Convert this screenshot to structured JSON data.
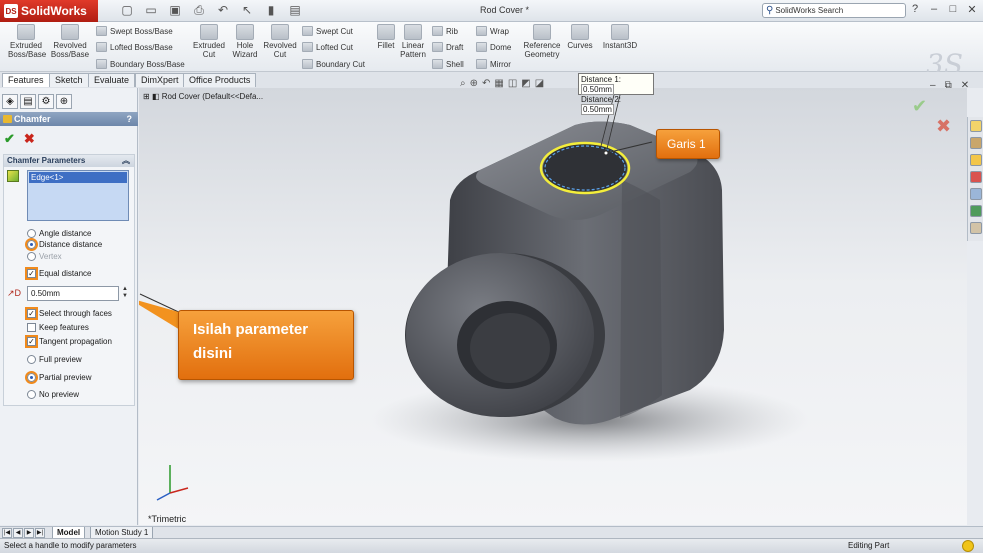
{
  "app": {
    "name": "SolidWorks",
    "doc_title": "Rod Cover *",
    "search_placeholder": "SolidWorks Search"
  },
  "ribbon": {
    "extruded_boss": "Extruded Boss/Base",
    "revolved_boss": "Revolved Boss/Base",
    "swept_boss": "Swept Boss/Base",
    "lofted_boss": "Lofted Boss/Base",
    "boundary_boss": "Boundary Boss/Base",
    "extruded_cut": "Extruded Cut",
    "hole_wizard": "Hole Wizard",
    "revolved_cut": "Revolved Cut",
    "swept_cut": "Swept Cut",
    "lofted_cut": "Lofted Cut",
    "boundary_cut": "Boundary Cut",
    "fillet": "Fillet",
    "linear_pattern": "Linear Pattern",
    "rib": "Rib",
    "draft": "Draft",
    "shell": "Shell",
    "wrap": "Wrap",
    "dome": "Dome",
    "mirror": "Mirror",
    "reference_geometry": "Reference Geometry",
    "curves": "Curves",
    "instant3d": "Instant3D"
  },
  "tabs": [
    "Features",
    "Sketch",
    "Evaluate",
    "DimXpert",
    "Office Products"
  ],
  "panel": {
    "title": "Chamfer",
    "help": "?",
    "group_title": "Chamfer Parameters",
    "selection": "Edge<1>",
    "angle_distance": "Angle distance",
    "distance_distance": "Distance distance",
    "vertex": "Vertex",
    "equal_distance": "Equal distance",
    "distance_value": "0.50mm",
    "select_through_faces": "Select through faces",
    "keep_features": "Keep features",
    "tangent_propagation": "Tangent propagation",
    "full_preview": "Full preview",
    "partial_preview": "Partial preview",
    "no_preview": "No preview"
  },
  "viewport": {
    "tree_label": "Rod Cover  (Default<<Defa...",
    "distance1": "Distance 1:",
    "distance1_value": "0.50mm",
    "distance2": "Distance 2:",
    "distance2_value": "0.50mm",
    "view_name": "*Trimetric"
  },
  "annotations": {
    "garis": "Garis 1",
    "instruction_line1": "Isilah parameter",
    "instruction_line2": "disini"
  },
  "bottom_tabs": [
    "Model",
    "Motion Study 1"
  ],
  "status": {
    "message": "Select a handle to modify parameters",
    "mode": "Editing Part"
  },
  "colors": {
    "accent_orange": "#e26f0e",
    "selection_blue": "#3e6fc4",
    "highlight_yellow": "#f4ee3a"
  },
  "icons": [
    "search-icon",
    "help-icon",
    "minimize-icon",
    "maximize-icon",
    "close-icon",
    "ok-check-icon",
    "cancel-x-icon",
    "warning-icon"
  ]
}
